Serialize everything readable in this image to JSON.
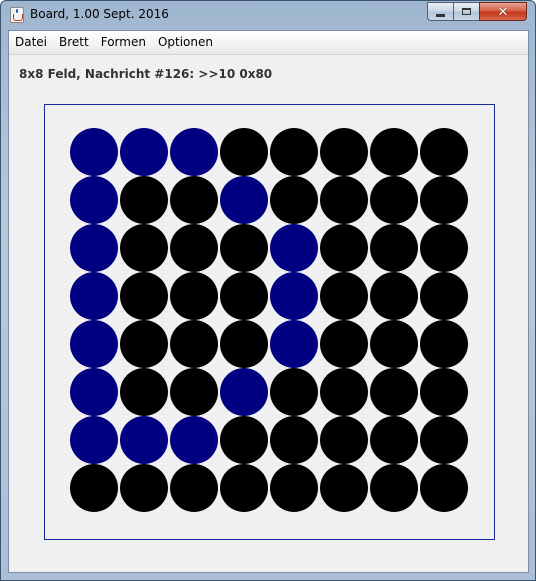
{
  "window": {
    "title": "Board, 1.00 Sept. 2016",
    "controls": {
      "minimize": "minimize",
      "maximize": "maximize",
      "close": "close"
    }
  },
  "menu": [
    "Datei",
    "Brett",
    "Formen",
    "Optionen"
  ],
  "status": "8x8 Feld, Nachricht #126: >>10 0x80",
  "board": {
    "rows": 8,
    "cols": 8,
    "colors": {
      "on": "#000080",
      "off": "#000000"
    },
    "cells": [
      [
        1,
        1,
        1,
        0,
        0,
        0,
        0,
        0
      ],
      [
        1,
        0,
        0,
        1,
        0,
        0,
        0,
        0
      ],
      [
        1,
        0,
        0,
        0,
        1,
        0,
        0,
        0
      ],
      [
        1,
        0,
        0,
        0,
        1,
        0,
        0,
        0
      ],
      [
        1,
        0,
        0,
        0,
        1,
        0,
        0,
        0
      ],
      [
        1,
        0,
        0,
        1,
        0,
        0,
        0,
        0
      ],
      [
        1,
        1,
        1,
        0,
        0,
        0,
        0,
        0
      ],
      [
        0,
        0,
        0,
        0,
        0,
        0,
        0,
        0
      ]
    ]
  }
}
